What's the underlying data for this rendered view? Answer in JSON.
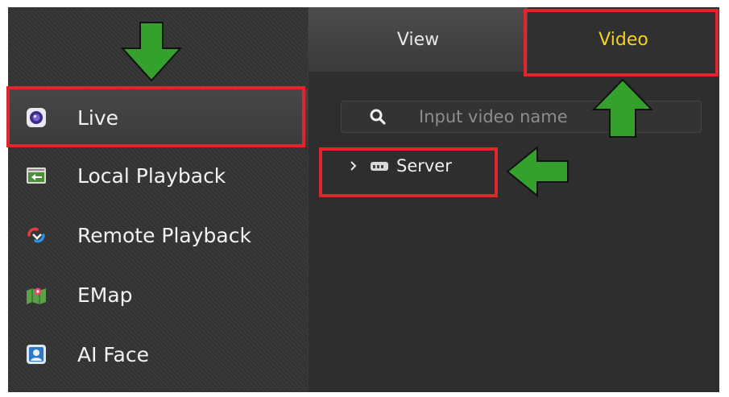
{
  "sidebar": {
    "items": [
      {
        "label": "Live",
        "icon": "live-camera-icon",
        "active": true
      },
      {
        "label": "Local Playback",
        "icon": "local-playback-icon",
        "active": false
      },
      {
        "label": "Remote Playback",
        "icon": "remote-playback-icon",
        "active": false
      },
      {
        "label": "EMap",
        "icon": "emap-icon",
        "active": false
      },
      {
        "label": "AI Face",
        "icon": "ai-face-icon",
        "active": false
      }
    ]
  },
  "tabs": [
    {
      "label": "View",
      "active": false
    },
    {
      "label": "Video",
      "active": true
    }
  ],
  "search": {
    "placeholder": "Input video name",
    "value": "",
    "icon": "search-icon"
  },
  "tree": [
    {
      "label": "Server",
      "icon": "server-icon",
      "expanded": false
    }
  ],
  "colors": {
    "accent_tab": "#f5d21a",
    "highlight_box": "#e0262b",
    "annotation_arrow": "#34a12c",
    "background": "#2b2b2b"
  }
}
